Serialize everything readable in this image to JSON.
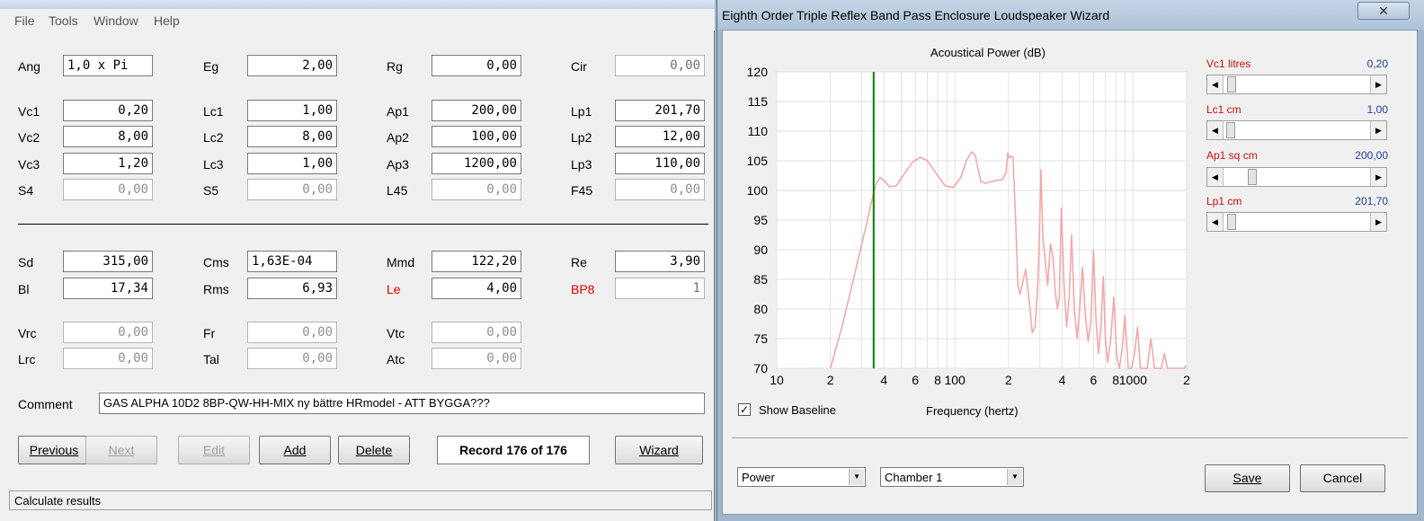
{
  "menu": [
    "File",
    "Tools",
    "Window",
    "Help"
  ],
  "fields": {
    "ang": {
      "label": "Ang",
      "value": "1,0 x Pi"
    },
    "eg": {
      "label": "Eg",
      "value": "2,00"
    },
    "rg": {
      "label": "Rg",
      "value": "0,00"
    },
    "cir": {
      "label": "Cir",
      "value": "0,00"
    },
    "vc1": {
      "label": "Vc1",
      "value": "0,20"
    },
    "lc1": {
      "label": "Lc1",
      "value": "1,00"
    },
    "ap1": {
      "label": "Ap1",
      "value": "200,00"
    },
    "lp1": {
      "label": "Lp1",
      "value": "201,70"
    },
    "vc2": {
      "label": "Vc2",
      "value": "8,00"
    },
    "lc2": {
      "label": "Lc2",
      "value": "8,00"
    },
    "ap2": {
      "label": "Ap2",
      "value": "100,00"
    },
    "lp2": {
      "label": "Lp2",
      "value": "12,00"
    },
    "vc3": {
      "label": "Vc3",
      "value": "1,20"
    },
    "lc3": {
      "label": "Lc3",
      "value": "1,00"
    },
    "ap3": {
      "label": "Ap3",
      "value": "1200,00"
    },
    "lp3": {
      "label": "Lp3",
      "value": "110,00"
    },
    "s4": {
      "label": "S4",
      "value": "0,00"
    },
    "s5": {
      "label": "S5",
      "value": "0,00"
    },
    "l45": {
      "label": "L45",
      "value": "0,00"
    },
    "f45": {
      "label": "F45",
      "value": "0,00"
    },
    "sd": {
      "label": "Sd",
      "value": "315,00"
    },
    "cms": {
      "label": "Cms",
      "value": "1,63E-04"
    },
    "mmd": {
      "label": "Mmd",
      "value": "122,20"
    },
    "re": {
      "label": "Re",
      "value": "3,90"
    },
    "bl": {
      "label": "Bl",
      "value": "17,34"
    },
    "rms": {
      "label": "Rms",
      "value": "6,93"
    },
    "le": {
      "label": "Le",
      "value": "4,00"
    },
    "bp8": {
      "label": "BP8",
      "value": "1"
    },
    "vrc": {
      "label": "Vrc",
      "value": "0,00"
    },
    "fr": {
      "label": "Fr",
      "value": "0,00"
    },
    "vtc": {
      "label": "Vtc",
      "value": "0,00"
    },
    "lrc": {
      "label": "Lrc",
      "value": "0,00"
    },
    "tal": {
      "label": "Tal",
      "value": "0,00"
    },
    "atc": {
      "label": "Atc",
      "value": "0,00"
    }
  },
  "comment": {
    "label": "Comment",
    "value": "GAS ALPHA 10D2 8BP-QW-HH-MIX ny bättre HRmodel - ATT BYGGA???"
  },
  "buttons": {
    "previous": "Previous",
    "next": "Next",
    "edit": "Edit",
    "add": "Add",
    "delete": "Delete",
    "wizard": "Wizard"
  },
  "record": "Record 176 of 176",
  "status": "Calculate results",
  "wizard": {
    "title": "Eighth Order Triple Reflex Band Pass Enclosure Loudspeaker Wizard",
    "close_glyph": "✕",
    "show_baseline": "Show Baseline",
    "show_baseline_checked": true,
    "combo_mode": "Power",
    "combo_chamber": "Chamber 1",
    "save": "Save",
    "cancel": "Cancel",
    "sliders": [
      {
        "label": "Vc1  litres",
        "value": "0,20",
        "position": 0.02
      },
      {
        "label": "Lc1  cm",
        "value": "1,00",
        "position": 0.01
      },
      {
        "label": "Ap1  sq cm",
        "value": "200,00",
        "position": 0.17
      },
      {
        "label": "Lp1  cm",
        "value": "201,70",
        "position": 0.02
      }
    ]
  },
  "chart_data": {
    "type": "line",
    "title": "Acoustical Power (dB)",
    "xlabel": "Frequency (hertz)",
    "ylabel": "",
    "x_scale": "log",
    "xlim": [
      10,
      2000
    ],
    "ylim": [
      70,
      120
    ],
    "x_tick_labels": [
      "10",
      "2",
      "4",
      "6",
      "8",
      "100",
      "2",
      "4",
      "6",
      "8",
      "1000",
      "2"
    ],
    "y_ticks": [
      70,
      75,
      80,
      85,
      90,
      95,
      100,
      105,
      110,
      115,
      120
    ],
    "grid": true,
    "marker_frequency": 35,
    "colors": {
      "series": "#f4a8a8",
      "marker": "#008000"
    },
    "series": [
      {
        "x": [
          20,
          23,
          26,
          29,
          32,
          34,
          36,
          38,
          40,
          43,
          47,
          52,
          58,
          64,
          70,
          78,
          88,
          98,
          108,
          116,
          124,
          130,
          134,
          140,
          148,
          160,
          172,
          184,
          194,
          198,
          202,
          206,
          212,
          220,
          226,
          232,
          240,
          250,
          262,
          272,
          282,
          292,
          298,
          304,
          312,
          322,
          332,
          344,
          356,
          366,
          376,
          386,
          396,
          410,
          424,
          438,
          452,
          468,
          486,
          502,
          520,
          540,
          560,
          580,
          600,
          620,
          640,
          660,
          680,
          700,
          720,
          750,
          780,
          810,
          840,
          870,
          900,
          940,
          980,
          1020,
          1060,
          1100,
          1150,
          1200,
          1260,
          1320,
          1380,
          1440,
          1500,
          1560,
          1620,
          1680,
          1740,
          1800,
          1870,
          1940,
          2000
        ],
        "y": [
          70,
          76.5,
          83,
          89,
          94.5,
          98,
          101,
          102.2,
          101.7,
          100.6,
          100.8,
          102.8,
          104.8,
          105.6,
          105,
          103,
          100.8,
          100.5,
          102.2,
          105,
          106.5,
          106,
          104,
          101.5,
          101.2,
          101.5,
          101.7,
          101.8,
          103,
          106.3,
          105.5,
          105.8,
          105.6,
          94,
          84,
          82.5,
          84.5,
          86.7,
          81,
          76,
          77,
          84,
          92,
          103.5,
          92,
          88,
          84,
          91,
          88.5,
          83,
          80,
          82,
          97,
          84,
          77,
          82,
          92.5,
          80,
          75,
          80,
          87,
          79,
          74.5,
          78,
          90,
          78,
          72.5,
          77,
          85.5,
          75,
          71,
          75,
          82,
          72,
          70,
          73.5,
          79,
          70,
          70,
          72.5,
          77,
          70,
          70,
          70,
          75,
          70,
          70,
          70,
          72.5,
          70,
          70,
          70,
          70,
          70,
          70,
          70,
          70.5
        ]
      }
    ]
  }
}
